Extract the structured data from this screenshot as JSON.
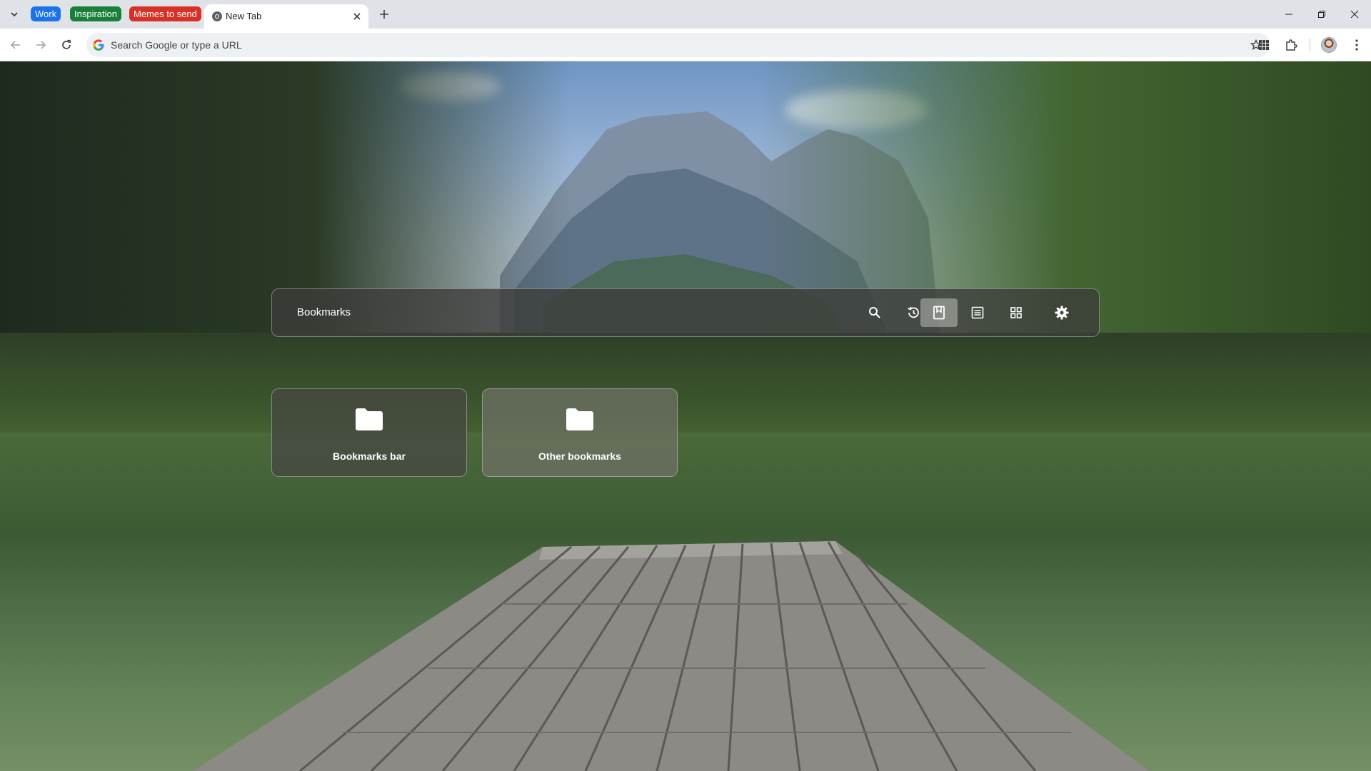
{
  "tabstrip": {
    "groups": [
      {
        "label": "Work",
        "color": "#1a73e8"
      },
      {
        "label": "Inspiration",
        "color": "#188038"
      },
      {
        "label": "Memes to send",
        "color": "#d93025"
      }
    ],
    "active_tab": {
      "title": "New Tab"
    }
  },
  "toolbar": {
    "omnibox_placeholder": "Search Google or type a URL"
  },
  "panel": {
    "title": "Bookmarks",
    "buttons": [
      {
        "name": "search-icon"
      },
      {
        "name": "history-icon"
      },
      {
        "name": "bookmark-icon",
        "active": true
      },
      {
        "name": "reading-list-icon"
      },
      {
        "name": "grid-icon"
      },
      {
        "name": "gear-icon"
      }
    ]
  },
  "bookmarks": [
    {
      "label": "Bookmarks bar",
      "icon": "folder-icon"
    },
    {
      "label": "Other bookmarks",
      "icon": "folder-icon"
    }
  ],
  "colors": {
    "tabstrip_bg": "#dfe3e7",
    "toolbar_bg": "#ffffff",
    "omnibox_bg": "#eef1f4"
  }
}
